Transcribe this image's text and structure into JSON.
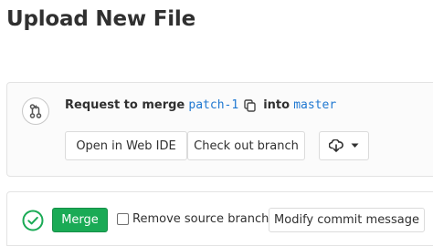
{
  "page": {
    "title": "Upload New File"
  },
  "merge_request": {
    "request_prefix": "Request to merge",
    "source_branch": "patch-1",
    "into_label": "into",
    "target_branch": "master",
    "buttons": {
      "open_web_ide": "Open in Web IDE",
      "check_out_branch": "Check out branch"
    }
  },
  "merge_action": {
    "merge_label": "Merge",
    "remove_source_branch_label": "Remove source branch",
    "remove_source_branch_checked": false,
    "modify_commit_message_label": "Modify commit message"
  },
  "colors": {
    "merge_green": "#1aaa55",
    "branch_blue": "#1f78d1",
    "success_green": "#1aaa55"
  },
  "icons": [
    "merge-request-icon",
    "copy-icon",
    "download-icon",
    "chevron-down-icon",
    "status-success-icon"
  ]
}
